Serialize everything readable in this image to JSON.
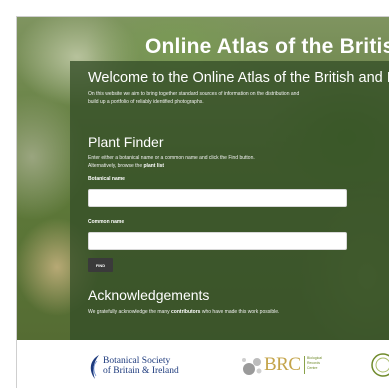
{
  "header": {
    "title": "Online Atlas of the British"
  },
  "welcome": {
    "heading": "Welcome to the Online Atlas of the British and I",
    "intro_line_1": "On this website we aim to bring together standard sources of information on the distribution and",
    "intro_line_2": "build up a portfolio of reliably identified photographs."
  },
  "plant_finder": {
    "heading": "Plant Finder",
    "hint_line_1": "Enter either a botanical name or a common name and click the Find button.",
    "hint_line_2_prefix": "Alternatively, browse the ",
    "plant_list_link": "plant list",
    "botanical_label": "Botanical name",
    "botanical_value": "",
    "common_label": "Common name",
    "common_value": "",
    "find_label": "FIND"
  },
  "acknowledgements": {
    "heading": "Acknowledgements",
    "text_prefix": "We gratefully acknowledge the many ",
    "contributors_link": "contributors",
    "text_suffix": " who have made this work possible."
  },
  "footer": {
    "bsbi_line_1": "Botanical Society",
    "bsbi_line_2": "of Britain & Ireland",
    "brc_mark": "BRC",
    "brc_sub_lines": "Biological\nRecords\nCentre"
  },
  "colors": {
    "panel": "#344e28",
    "bsbi_blue": "#1d3a7d",
    "brc_gold": "#c4a44a",
    "find_button": "#3a3a3a"
  }
}
